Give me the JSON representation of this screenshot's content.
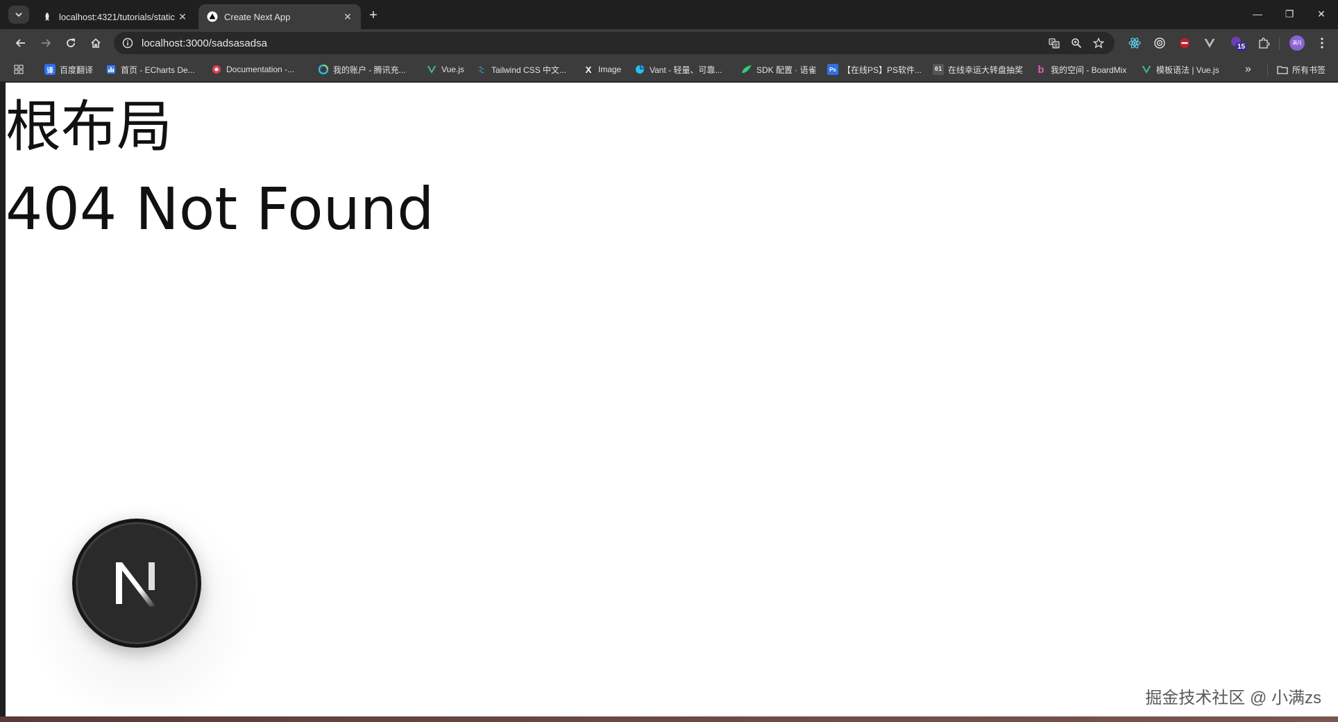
{
  "browser": {
    "tabs": [
      {
        "title": "localhost:4321/tutorials/static",
        "active": false
      },
      {
        "title": "Create Next App",
        "active": true
      }
    ],
    "new_tab_label": "+",
    "window_controls": {
      "minimize": "—",
      "restore": "❐",
      "close": "✕"
    },
    "url": "localhost:3000/sadsasadsa",
    "extension_badge": "15",
    "profile_label": "满月"
  },
  "bookmarks": {
    "items": [
      {
        "label": "百度翻译",
        "icon": "译",
        "color": "#2d6cf0"
      },
      {
        "label": "首页 - ECharts De...",
        "icon": "▮",
        "color": "#3d7fff"
      },
      {
        "label": "Documentation -...",
        "icon": "●",
        "color": "#e0405a"
      },
      {
        "label": "我的账户 - 腾讯充...",
        "icon": "◍",
        "color": "#33b5e5"
      },
      {
        "label": "Vue.js",
        "icon": "V",
        "color": "#41b883"
      },
      {
        "label": "Tailwind CSS 中文...",
        "icon": "≈",
        "color": "#38bdf8"
      },
      {
        "label": "Image",
        "icon": "X",
        "color": "#ffffff"
      },
      {
        "label": "Vant - 轻量、可靠...",
        "icon": "◗",
        "color": "#22c3ee"
      },
      {
        "label": "SDK 配置 · 语雀",
        "icon": "❧",
        "color": "#31cc79"
      },
      {
        "label": "【在线PS】PS软件...",
        "icon": "Ps",
        "color": "#2f6fe0"
      },
      {
        "label": "在线幸运大转盘抽奖",
        "icon": "01",
        "color": "#cccccc"
      },
      {
        "label": "我的空间 - BoardMix",
        "icon": "b",
        "color": "#e85ab8"
      },
      {
        "label": "模板语法 | Vue.js",
        "icon": "V",
        "color": "#41b883"
      }
    ],
    "overflow_label": "»",
    "all_bookmarks_label": "所有书签"
  },
  "page": {
    "root_layout_heading": "根布局",
    "not_found_heading": "404 Not Found",
    "next_logo_letter": "N",
    "watermark": "掘金技术社区 @ 小满zs"
  }
}
